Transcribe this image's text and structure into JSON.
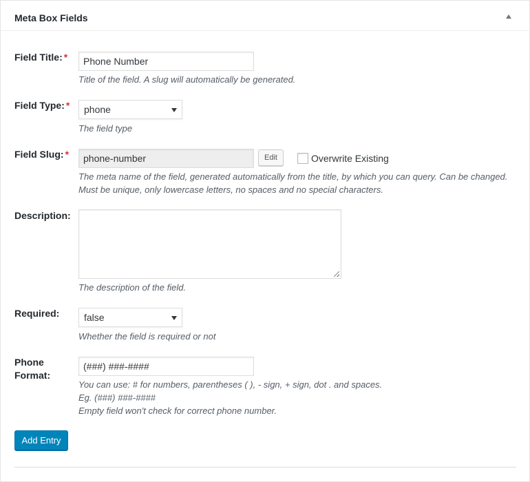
{
  "metabox": {
    "title": "Meta Box Fields"
  },
  "fields": {
    "title": {
      "label": "Field Title:",
      "required": "*",
      "value": "Phone Number",
      "description": "Title of the field. A slug will automatically be generated."
    },
    "type": {
      "label": "Field Type:",
      "required": "*",
      "selected": "phone",
      "description": "The field type"
    },
    "slug": {
      "label": "Field Slug:",
      "required": "*",
      "value": "phone-number",
      "edit_label": "Edit",
      "overwrite_label": "Overwrite Existing",
      "overwrite_checked": false,
      "description_line1": "The meta name of the field, generated automatically from the title, by which you can query. Can be changed.",
      "description_line2": "Must be unique, only lowercase letters, no spaces and no special characters."
    },
    "description": {
      "label": "Description:",
      "value": "",
      "description": "The description of the field."
    },
    "required": {
      "label": "Required:",
      "selected": "false",
      "description": "Whether the field is required or not"
    },
    "phone_format": {
      "label_line1": "Phone",
      "label_line2": "Format:",
      "value": "(###) ###-####",
      "help_line1": "You can use: # for numbers, parentheses ( ), - sign, + sign, dot . and spaces.",
      "help_line2": "Eg. (###) ###-####",
      "help_line3": "Empty field won't check for correct phone number."
    }
  },
  "actions": {
    "add_entry_label": "Add Entry"
  },
  "colors": {
    "primary_button": "#0085ba",
    "required_marker": "#dc3232",
    "description_text": "#555d66"
  }
}
